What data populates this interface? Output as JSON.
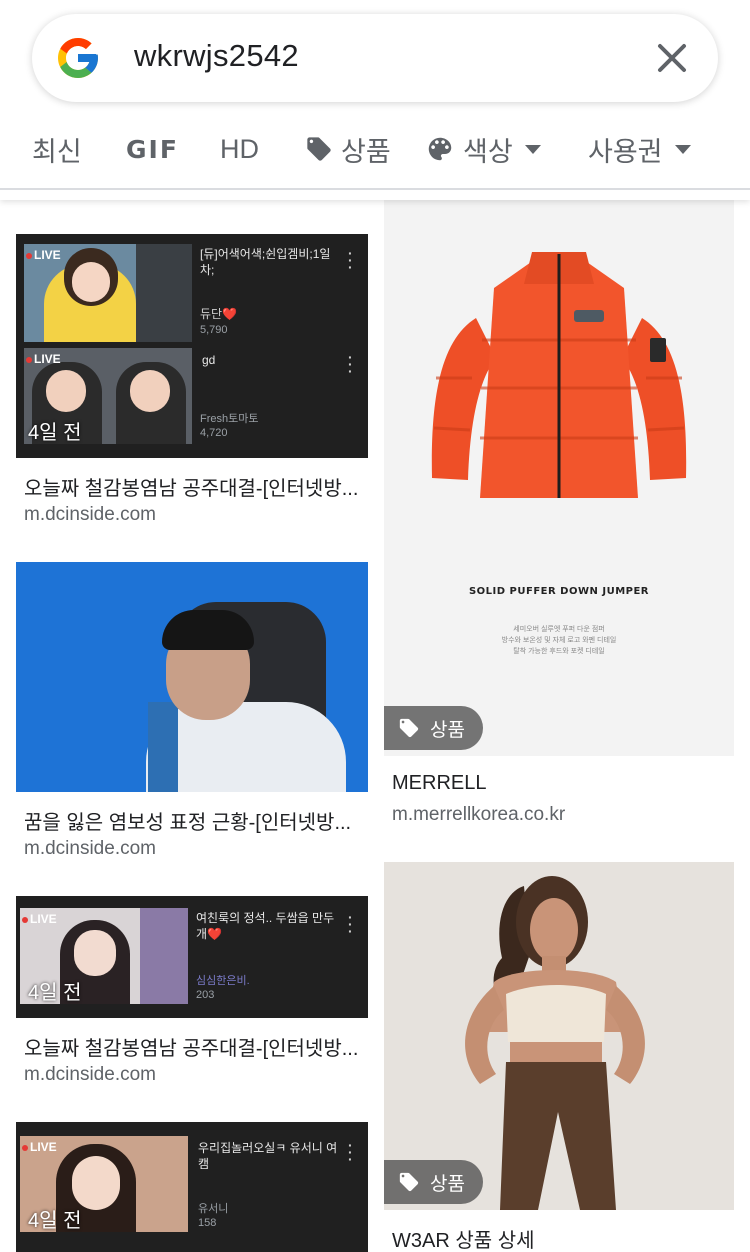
{
  "search": {
    "query": "wkrwjs2542",
    "logo_icon": "google-g-icon",
    "clear_icon": "close-icon"
  },
  "chips": {
    "latest": "최신",
    "gif": "GIF",
    "hd": "HD",
    "products": "상품",
    "products_icon": "tag-icon",
    "color": "색상",
    "color_icon": "palette-icon",
    "rights": "사용권",
    "caret_icon": "chevron-down-icon"
  },
  "results": [
    {
      "title": "오늘짜 철감봉염남 공주대결-[인터넷방...",
      "source": "m.dcinside.com",
      "age": "4일 전",
      "live_label": "LIVE",
      "streams": [
        {
          "title": "[듀]어색어색;쉰입겜비;1일차;",
          "channel": "듀단❤️",
          "viewers": "5,790"
        },
        {
          "title": "gd",
          "channel": "Fresh토마토",
          "viewers": "4,720"
        }
      ]
    },
    {
      "title": "꿈을 잃은 염보성 표정 근황-[인터넷방...",
      "source": "m.dcinside.com"
    },
    {
      "title": "오늘짜 철감봉염남 공주대결-[인터넷방...",
      "source": "m.dcinside.com",
      "age": "4일 전",
      "live_label": "LIVE",
      "streams": [
        {
          "title": "여친룩의 정석.. 두쌈읍 만두개❤️",
          "channel": "심심한은비.",
          "viewers": "203"
        }
      ]
    },
    {
      "title": "",
      "source": "",
      "age": "4일 전",
      "live_label": "LIVE",
      "streams": [
        {
          "title": "우리집놀러오실ㅋ 유서니 여캠",
          "channel": "유서니",
          "viewers": "158"
        }
      ]
    },
    {
      "title": "MERRELL",
      "source": "m.merrellkorea.co.kr",
      "product_label": "상품",
      "caption_main": "SOLID PUFFER DOWN JUMPER",
      "caption_sub": [
        "세미오버 실루엣 푸퍼 다운 점퍼",
        "방수와 보온성 및 자체 로고 와펜 디테일",
        "탈착 가능한 후드와 포켓 디테일"
      ]
    },
    {
      "title": "W3AR 상품 상세",
      "source": "",
      "product_label": "상품"
    }
  ],
  "colors": {
    "jacket": "#f2552c",
    "live_bg": "#1f1f1f",
    "blue_bg": "#1e73d6"
  }
}
